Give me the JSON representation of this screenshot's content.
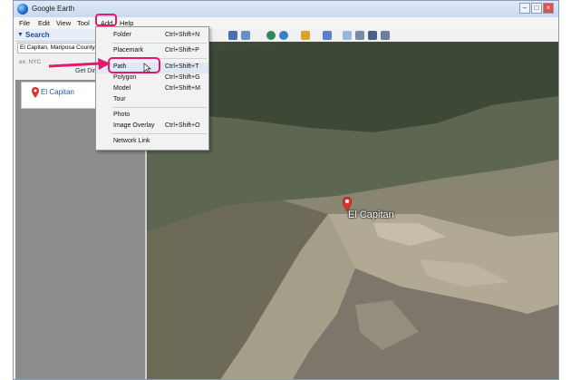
{
  "window": {
    "title": "Google Earth",
    "controls": [
      "–",
      "□",
      "×"
    ]
  },
  "menubar": {
    "items": [
      "File",
      "Edit",
      "View",
      "Tool",
      "Add",
      "Help"
    ]
  },
  "search_panel": {
    "title": "Search",
    "input_value": "El Capitan, Mariposa County, CA",
    "hint": "ex: NYC",
    "get_directions": "Get Dir",
    "results": [
      {
        "label": "El Capitan"
      }
    ]
  },
  "add_menu": {
    "items": [
      {
        "label": "Folder",
        "shortcut": "Ctrl+Shift+N"
      },
      {
        "label": "Placemark",
        "shortcut": "Ctrl+Shift+P"
      },
      {
        "label": "Path",
        "shortcut": "Ctrl+Shift+T"
      },
      {
        "label": "Polygon",
        "shortcut": "Ctrl+Shift+G"
      },
      {
        "label": "Model",
        "shortcut": "Ctrl+Shift+M"
      },
      {
        "label": "Tour",
        "shortcut": ""
      },
      {
        "label": "Photo",
        "shortcut": ""
      },
      {
        "label": "Image Overlay",
        "shortcut": "Ctrl+Shift+O"
      },
      {
        "label": "Network Link",
        "shortcut": ""
      }
    ]
  },
  "map": {
    "placemark_label": "El Capitan"
  },
  "colors": {
    "highlight": "#e5186b",
    "accent_link": "#2256b0"
  }
}
